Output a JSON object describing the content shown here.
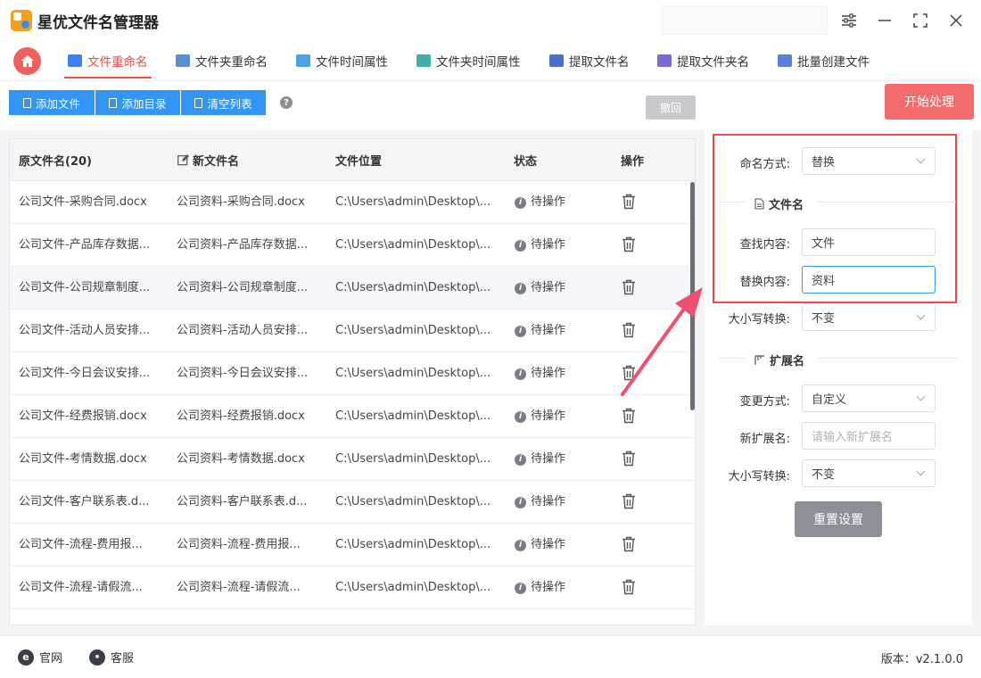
{
  "app": {
    "title": "星优文件名管理器"
  },
  "tabs": [
    {
      "label": "文件重命名",
      "color": "#3f7ff5",
      "active": true
    },
    {
      "label": "文件夹重命名",
      "color": "#5b8dd6"
    },
    {
      "label": "文件时间属性",
      "color": "#4aa3df"
    },
    {
      "label": "文件夹时间属性",
      "color": "#3cb0a4"
    },
    {
      "label": "提取文件名",
      "color": "#4a6fd1"
    },
    {
      "label": "提取文件夹名",
      "color": "#7a6ad8"
    },
    {
      "label": "批量创建文件",
      "color": "#5a7fd8"
    }
  ],
  "toolbar": {
    "add_file": "添加文件",
    "add_dir": "添加目录",
    "clear_list": "清空列表",
    "help": "?",
    "undo": "撤回",
    "start": "开始处理"
  },
  "table": {
    "headers": {
      "original": "原文件名(20)",
      "new": "新文件名",
      "location": "文件位置",
      "status": "状态",
      "action": "操作"
    },
    "rows": [
      {
        "original": "公司文件-采购合同.docx",
        "new": "公司资料-采购合同.docx",
        "location": "C:\\Users\\admin\\Desktop\\...",
        "status": "待操作"
      },
      {
        "original": "公司文件-产品库存数据...",
        "new": "公司资料-产品库存数据...",
        "location": "C:\\Users\\admin\\Desktop\\...",
        "status": "待操作"
      },
      {
        "original": "公司文件-公司规章制度...",
        "new": "公司资料-公司规章制度...",
        "location": "C:\\Users\\admin\\Desktop\\...",
        "status": "待操作"
      },
      {
        "original": "公司文件-活动人员安排...",
        "new": "公司资料-活动人员安排...",
        "location": "C:\\Users\\admin\\Desktop\\...",
        "status": "待操作"
      },
      {
        "original": "公司文件-今日会议安排...",
        "new": "公司资料-今日会议安排...",
        "location": "C:\\Users\\admin\\Desktop\\...",
        "status": "待操作"
      },
      {
        "original": "公司文件-经费报销.docx",
        "new": "公司资料-经费报销.docx",
        "location": "C:\\Users\\admin\\Desktop\\...",
        "status": "待操作"
      },
      {
        "original": "公司文件-考情数据.docx",
        "new": "公司资料-考情数据.docx",
        "location": "C:\\Users\\admin\\Desktop\\...",
        "status": "待操作"
      },
      {
        "original": "公司文件-客户联系表.d...",
        "new": "公司资料-客户联系表.d...",
        "location": "C:\\Users\\admin\\Desktop\\...",
        "status": "待操作"
      },
      {
        "original": "公司文件-流程-费用报...",
        "new": "公司资料-流程-费用报...",
        "location": "C:\\Users\\admin\\Desktop\\...",
        "status": "待操作"
      },
      {
        "original": "公司文件-流程-请假流...",
        "new": "公司资料-流程-请假流...",
        "location": "C:\\Users\\admin\\Desktop\\...",
        "status": "待操作"
      }
    ]
  },
  "settings": {
    "naming_method_label": "命名方式:",
    "naming_method_value": "替换",
    "filename_section": "文件名",
    "find_label": "查找内容:",
    "find_value": "文件",
    "replace_label": "替换内容:",
    "replace_value": "资料",
    "case1_label": "大小写转换:",
    "case1_value": "不变",
    "ext_section": "扩展名",
    "change_method_label": "变更方式:",
    "change_method_value": "自定义",
    "new_ext_label": "新扩展名:",
    "new_ext_placeholder": "请输入新扩展名",
    "case2_label": "大小写转换:",
    "case2_value": "不变",
    "reset": "重置设置"
  },
  "footer": {
    "website": "官网",
    "support": "客服",
    "version": "版本：v2.1.0.0"
  },
  "colors": {
    "accent": "#e9504c",
    "primary": "#3296f6",
    "highlight_box": "#e84c4c"
  }
}
